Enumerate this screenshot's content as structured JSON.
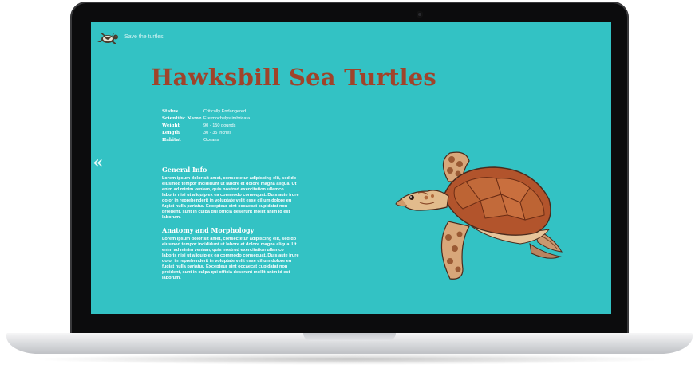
{
  "site": {
    "tagline": "Save the turtles!",
    "logo_icon": "turtle-logo-icon"
  },
  "page": {
    "title": "Hawksbill Sea Turtles"
  },
  "facts": [
    {
      "label": "Status",
      "value": "Critically Endangered"
    },
    {
      "label": "Scientific Name",
      "value": "Eretmochelys imbricata"
    },
    {
      "label": "Weight",
      "value": "90 - 150 pounds"
    },
    {
      "label": "Length",
      "value": "30 - 35 inches"
    },
    {
      "label": "Habitat",
      "value": "Oceans"
    }
  ],
  "navigation": {
    "prev_label": "«",
    "prev_icon": "double-chevron-left-icon"
  },
  "sections": [
    {
      "heading": "General Info",
      "body": "Lorem ipsum dolor sit amet, consectetur adipiscing elit, sed do eiusmod tempor incididunt ut labore et dolore magna aliqua. Ut enim ad minim veniam, quis nostrud exercitation ullamco laboris nisi ut aliquip ex ea commodo consequat. Duis aute irure dolor in reprehenderit in voluptate velit esse cillum dolore eu fugiat nulla pariatur. Excepteur sint occaecat cupidatat non proident, sunt in culpa qui officia deserunt mollit anim id est laborum."
    },
    {
      "heading": "Anatomy and Morphology",
      "body": "Lorem ipsum dolor sit amet, consectetur adipiscing elit, sed do eiusmod tempor incididunt ut labore et dolore magna aliqua. Ut enim ad minim veniam, quis nostrud exercitation ullamco laboris nisi ut aliquip ex ea commodo consequat. Duis aute irure dolor in reprehenderit in voluptate velit esse cillum dolore eu fugiat nulla pariatur. Excepteur sint occaecat cupidatat non proident, sunt in culpa qui officia deserunt mollit anim id est laborum."
    }
  ],
  "illustration": {
    "icon": "hawksbill-turtle-illustration"
  },
  "colors": {
    "screen_background": "#33c2c4",
    "title": "#a0432a",
    "text": "#ffffff",
    "laptop_bezel": "#0c0c0d",
    "laptop_base": "#dcdde0"
  }
}
